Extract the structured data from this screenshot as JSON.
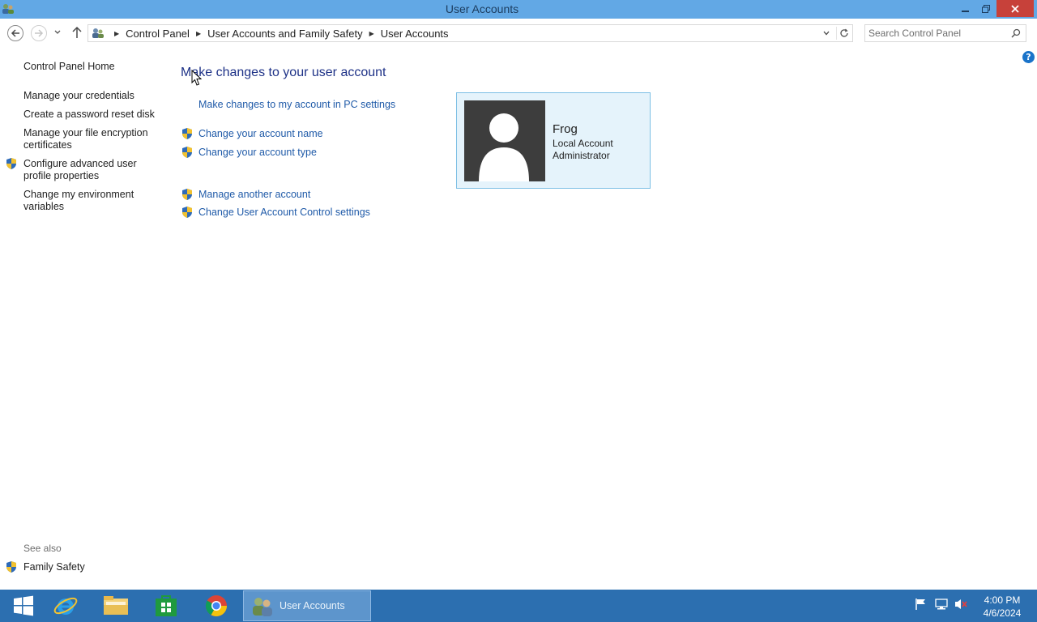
{
  "window": {
    "title": "User Accounts",
    "controls": {
      "minimize": "minimize-icon",
      "restore": "restore-icon",
      "close": "close-icon"
    }
  },
  "address_bar": {
    "breadcrumbs": [
      "Control Panel",
      "User Accounts and Family Safety",
      "User Accounts"
    ]
  },
  "search": {
    "placeholder": "Search Control Panel"
  },
  "help": {
    "label": "?"
  },
  "left_pane": {
    "home": "Control Panel Home",
    "links": [
      "Manage your credentials",
      "Create a password reset disk",
      "Manage your file encryption certificates",
      "Configure advanced user profile properties",
      "Change my environment variables"
    ],
    "see_also_label": "See also",
    "see_also_links": [
      "Family Safety"
    ]
  },
  "main": {
    "heading": "Make changes to your user account",
    "pc_settings_link": "Make changes to my account in PC settings",
    "tasks": [
      "Change your account name",
      "Change your account type",
      "Manage another account",
      "Change User Account Control settings"
    ],
    "account": {
      "name": "Frog",
      "type": "Local Account",
      "role": "Administrator"
    }
  },
  "taskbar": {
    "pinned": [
      "start-icon",
      "internet-explorer-icon",
      "file-explorer-icon",
      "store-icon",
      "chrome-icon"
    ],
    "active_app": "User Accounts",
    "clock": {
      "time": "4:00 PM",
      "date": "4/6/2024"
    }
  },
  "colors": {
    "titlebar": "#62a8e5",
    "close_button": "#c7413a",
    "link": "#1f5aa8",
    "heading": "#1e3287",
    "card_bg": "#e5f3fb",
    "card_border": "#7dbfe4",
    "taskbar": "#2c6fb0"
  }
}
